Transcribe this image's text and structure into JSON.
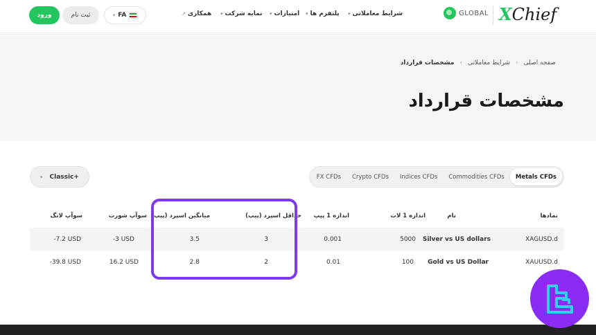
{
  "header": {
    "login_label": "ورود",
    "register_label": "ثبت نام",
    "language": "FA",
    "nav": [
      {
        "label": "شرایط معاملاتی"
      },
      {
        "label": "پلتفرم ها"
      },
      {
        "label": "امتیازات"
      },
      {
        "label": "نمایه شرکت"
      },
      {
        "label": "همکاری"
      }
    ],
    "global_label": "GLOBAL",
    "brand_x": "X",
    "brand_rest": "Chief"
  },
  "hero": {
    "breadcrumb": [
      "صفحه اصلی",
      "شرایط معاملاتی",
      "مشخصات قرارداد"
    ],
    "title": "مشخصات قرارداد"
  },
  "tabs": [
    {
      "label": "Metals CFDs",
      "active": true
    },
    {
      "label": "Commodities CFDs",
      "active": false
    },
    {
      "label": "Indices CFDs",
      "active": false
    },
    {
      "label": "Crypto CFDs",
      "active": false
    },
    {
      "label": "FX CFDs",
      "active": false
    }
  ],
  "account_select": {
    "label": "Classic+"
  },
  "table": {
    "headers": [
      "نمادها",
      "نام",
      "اندازه 1 لات",
      "اندازه 1 پیپ",
      "حداقل اسپرد (پیپ)",
      "میانگین اسپرد (پیپ)",
      "سوآپ شورت",
      "سوآپ لانگ"
    ],
    "rows": [
      [
        "XAGUSD.d",
        "Silver vs US dollars",
        "5000",
        "0.001",
        "3",
        "3.5",
        "-3 USD",
        "-7.2 USD"
      ],
      [
        "XAUUSD.d",
        "Gold vs US Dollar",
        "100",
        "0.01",
        "2",
        "2.8",
        "16.2 USD",
        "-39.8 USD"
      ]
    ]
  },
  "colors": {
    "accent": "#22c55e",
    "highlight": "#7c3aed",
    "corner_logo_bg": "#8b2cf5",
    "corner_logo_fg": "#2fd0f0"
  }
}
